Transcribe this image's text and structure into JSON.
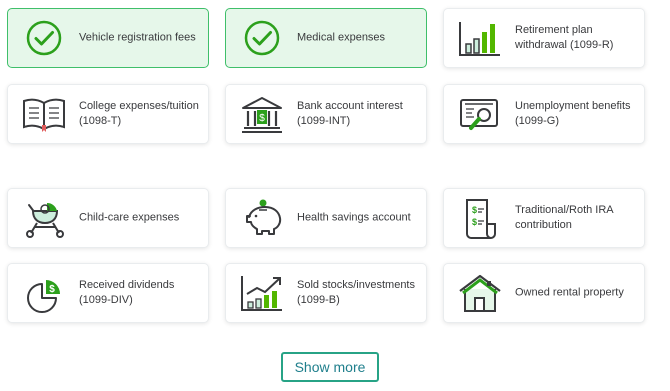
{
  "cards": [
    {
      "id": "vehicle",
      "label": "Vehicle registration fees",
      "sub": "",
      "icon": "check-circle-icon",
      "selected": true
    },
    {
      "id": "medical",
      "label": "Medical expenses",
      "sub": "",
      "icon": "check-circle-icon",
      "selected": true
    },
    {
      "id": "retirement",
      "label": "Retirement plan",
      "sub": "withdrawal (1099-R)",
      "icon": "bar-chart-icon",
      "selected": false
    },
    {
      "id": "college",
      "label": "College expenses/tuition",
      "sub": "(1098-T)",
      "icon": "open-book-icon",
      "selected": false
    },
    {
      "id": "bank",
      "label": "Bank account interest",
      "sub": "(1099-INT)",
      "icon": "bank-icon",
      "selected": false
    },
    {
      "id": "unemployment",
      "label": "Unemployment benefits",
      "sub": "(1099-G)",
      "icon": "document-magnifier-icon",
      "selected": false
    },
    {
      "id": "childcare",
      "label": "Child-care expenses",
      "sub": "",
      "icon": "stroller-icon",
      "selected": false
    },
    {
      "id": "hsa",
      "label": "Health savings account",
      "sub": "",
      "icon": "piggy-bank-icon",
      "selected": false
    },
    {
      "id": "ira",
      "label": "Traditional/Roth IRA",
      "sub": "contribution",
      "icon": "dollar-document-icon",
      "selected": false
    },
    {
      "id": "dividends",
      "label": "Received dividends",
      "sub": "(1099-DIV)",
      "icon": "pie-dollar-icon",
      "selected": false
    },
    {
      "id": "stocks",
      "label": "Sold stocks/investments",
      "sub": "(1099-B)",
      "icon": "growth-chart-icon",
      "selected": false
    },
    {
      "id": "rental",
      "label": "Owned rental property",
      "sub": "",
      "icon": "house-icon",
      "selected": false
    }
  ],
  "show_more_label": "Show more",
  "colors": {
    "accent_green": "#2ca01c",
    "selected_bg": "#e6f7ea",
    "icon_stroke": "#393a3d",
    "button_text": "#1f7f8c"
  }
}
